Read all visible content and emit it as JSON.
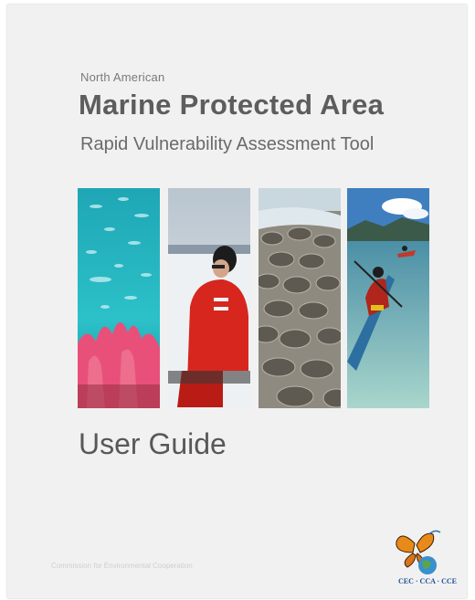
{
  "cover": {
    "supertitle": "North American",
    "title": "Marine Protected Area",
    "subtitle": "Rapid Vulnerability Assessment Tool",
    "guide_title": "User Guide",
    "organization": "Commission for Environmental Cooperation",
    "logo_text": "CEC · CCA · CCE"
  },
  "photos": [
    {
      "icon": "coral-reef-fish-photo"
    },
    {
      "icon": "person-red-survival-suit-arctic-photo"
    },
    {
      "icon": "horseshoe-crabs-shore-photo"
    },
    {
      "icon": "kayakers-clear-water-photo"
    }
  ],
  "colors": {
    "page_bg": "#f1f1f1",
    "title_gray": "#5d5d5d",
    "accent_red": "#d6261d",
    "water_teal": "#2fb8c7"
  }
}
